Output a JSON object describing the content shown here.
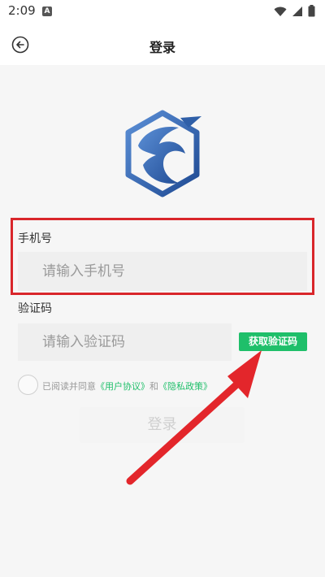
{
  "status_bar": {
    "time": "2:09",
    "app_icon_letter": "A"
  },
  "header": {
    "title": "登录"
  },
  "form": {
    "phone_label": "手机号",
    "phone_placeholder": "请输入手机号",
    "code_label": "验证码",
    "code_placeholder": "请输入验证码",
    "get_code_label": "获取验证码",
    "agreement_prefix": "已阅读并同意",
    "agreement_user": "《用户协议》",
    "agreement_and": "和",
    "agreement_privacy": "《隐私政策》",
    "login_label": "登录"
  },
  "colors": {
    "accent_green": "#1fbf6a",
    "annotation_red": "#d9262b",
    "logo_blue": "#2f5fa8"
  },
  "annotations": {
    "highlight": "red-rectangle-around-phone-field",
    "arrow": "red-arrow-pointing-to-get-code-button"
  }
}
